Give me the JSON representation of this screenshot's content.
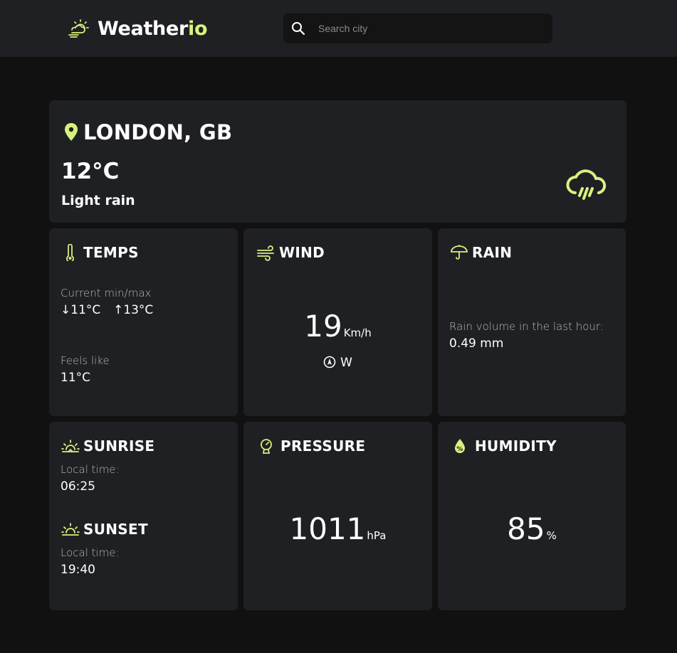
{
  "header": {
    "brand_main": "Weather",
    "brand_accent": "io",
    "logo_icon": "sun-cloud-icon",
    "search_placeholder": "Search city",
    "search_icon": "search-icon"
  },
  "colors": {
    "accent": "#d6f27e",
    "background": "#111111",
    "card": "#1f2024"
  },
  "current": {
    "location": "LONDON, GB",
    "temperature": "12°C",
    "description": "Light rain",
    "weather_icon": "rain-cloud-icon"
  },
  "temps": {
    "title": "TEMPS",
    "minmax_label": "Current min/max",
    "min_arrow": "↓",
    "min": "11°C",
    "max_arrow": "↑",
    "max": "13°C",
    "feels_label": "Feels like",
    "feels": "11°C"
  },
  "wind": {
    "title": "WIND",
    "speed": "19",
    "unit": "Km/h",
    "direction": "W"
  },
  "rain": {
    "title": "RAIN",
    "label": "Rain volume in the last hour:",
    "value": "0.49 mm"
  },
  "sun": {
    "sunrise_title": "SUNRISE",
    "sunrise_label": "Local time:",
    "sunrise_time": "06:25",
    "sunset_title": "SUNSET",
    "sunset_label": "Local time:",
    "sunset_time": "19:40"
  },
  "pressure": {
    "title": "PRESSURE",
    "value": "1011",
    "unit": "hPa"
  },
  "humidity": {
    "title": "HUMIDITY",
    "value": "85",
    "unit": "%"
  }
}
